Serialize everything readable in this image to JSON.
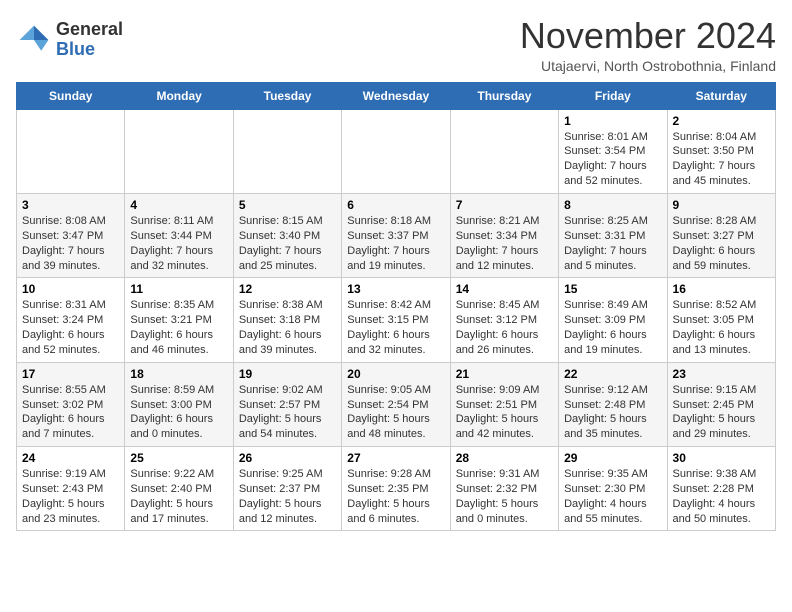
{
  "logo": {
    "general": "General",
    "blue": "Blue"
  },
  "header": {
    "title": "November 2024",
    "location": "Utajaervi, North Ostrobothnia, Finland"
  },
  "weekdays": [
    "Sunday",
    "Monday",
    "Tuesday",
    "Wednesday",
    "Thursday",
    "Friday",
    "Saturday"
  ],
  "weeks": [
    [
      {
        "day": "",
        "content": ""
      },
      {
        "day": "",
        "content": ""
      },
      {
        "day": "",
        "content": ""
      },
      {
        "day": "",
        "content": ""
      },
      {
        "day": "",
        "content": ""
      },
      {
        "day": "1",
        "content": "Sunrise: 8:01 AM\nSunset: 3:54 PM\nDaylight: 7 hours\nand 52 minutes."
      },
      {
        "day": "2",
        "content": "Sunrise: 8:04 AM\nSunset: 3:50 PM\nDaylight: 7 hours\nand 45 minutes."
      }
    ],
    [
      {
        "day": "3",
        "content": "Sunrise: 8:08 AM\nSunset: 3:47 PM\nDaylight: 7 hours\nand 39 minutes."
      },
      {
        "day": "4",
        "content": "Sunrise: 8:11 AM\nSunset: 3:44 PM\nDaylight: 7 hours\nand 32 minutes."
      },
      {
        "day": "5",
        "content": "Sunrise: 8:15 AM\nSunset: 3:40 PM\nDaylight: 7 hours\nand 25 minutes."
      },
      {
        "day": "6",
        "content": "Sunrise: 8:18 AM\nSunset: 3:37 PM\nDaylight: 7 hours\nand 19 minutes."
      },
      {
        "day": "7",
        "content": "Sunrise: 8:21 AM\nSunset: 3:34 PM\nDaylight: 7 hours\nand 12 minutes."
      },
      {
        "day": "8",
        "content": "Sunrise: 8:25 AM\nSunset: 3:31 PM\nDaylight: 7 hours\nand 5 minutes."
      },
      {
        "day": "9",
        "content": "Sunrise: 8:28 AM\nSunset: 3:27 PM\nDaylight: 6 hours\nand 59 minutes."
      }
    ],
    [
      {
        "day": "10",
        "content": "Sunrise: 8:31 AM\nSunset: 3:24 PM\nDaylight: 6 hours\nand 52 minutes."
      },
      {
        "day": "11",
        "content": "Sunrise: 8:35 AM\nSunset: 3:21 PM\nDaylight: 6 hours\nand 46 minutes."
      },
      {
        "day": "12",
        "content": "Sunrise: 8:38 AM\nSunset: 3:18 PM\nDaylight: 6 hours\nand 39 minutes."
      },
      {
        "day": "13",
        "content": "Sunrise: 8:42 AM\nSunset: 3:15 PM\nDaylight: 6 hours\nand 32 minutes."
      },
      {
        "day": "14",
        "content": "Sunrise: 8:45 AM\nSunset: 3:12 PM\nDaylight: 6 hours\nand 26 minutes."
      },
      {
        "day": "15",
        "content": "Sunrise: 8:49 AM\nSunset: 3:09 PM\nDaylight: 6 hours\nand 19 minutes."
      },
      {
        "day": "16",
        "content": "Sunrise: 8:52 AM\nSunset: 3:05 PM\nDaylight: 6 hours\nand 13 minutes."
      }
    ],
    [
      {
        "day": "17",
        "content": "Sunrise: 8:55 AM\nSunset: 3:02 PM\nDaylight: 6 hours\nand 7 minutes."
      },
      {
        "day": "18",
        "content": "Sunrise: 8:59 AM\nSunset: 3:00 PM\nDaylight: 6 hours\nand 0 minutes."
      },
      {
        "day": "19",
        "content": "Sunrise: 9:02 AM\nSunset: 2:57 PM\nDaylight: 5 hours\nand 54 minutes."
      },
      {
        "day": "20",
        "content": "Sunrise: 9:05 AM\nSunset: 2:54 PM\nDaylight: 5 hours\nand 48 minutes."
      },
      {
        "day": "21",
        "content": "Sunrise: 9:09 AM\nSunset: 2:51 PM\nDaylight: 5 hours\nand 42 minutes."
      },
      {
        "day": "22",
        "content": "Sunrise: 9:12 AM\nSunset: 2:48 PM\nDaylight: 5 hours\nand 35 minutes."
      },
      {
        "day": "23",
        "content": "Sunrise: 9:15 AM\nSunset: 2:45 PM\nDaylight: 5 hours\nand 29 minutes."
      }
    ],
    [
      {
        "day": "24",
        "content": "Sunrise: 9:19 AM\nSunset: 2:43 PM\nDaylight: 5 hours\nand 23 minutes."
      },
      {
        "day": "25",
        "content": "Sunrise: 9:22 AM\nSunset: 2:40 PM\nDaylight: 5 hours\nand 17 minutes."
      },
      {
        "day": "26",
        "content": "Sunrise: 9:25 AM\nSunset: 2:37 PM\nDaylight: 5 hours\nand 12 minutes."
      },
      {
        "day": "27",
        "content": "Sunrise: 9:28 AM\nSunset: 2:35 PM\nDaylight: 5 hours\nand 6 minutes."
      },
      {
        "day": "28",
        "content": "Sunrise: 9:31 AM\nSunset: 2:32 PM\nDaylight: 5 hours\nand 0 minutes."
      },
      {
        "day": "29",
        "content": "Sunrise: 9:35 AM\nSunset: 2:30 PM\nDaylight: 4 hours\nand 55 minutes."
      },
      {
        "day": "30",
        "content": "Sunrise: 9:38 AM\nSunset: 2:28 PM\nDaylight: 4 hours\nand 50 minutes."
      }
    ]
  ]
}
